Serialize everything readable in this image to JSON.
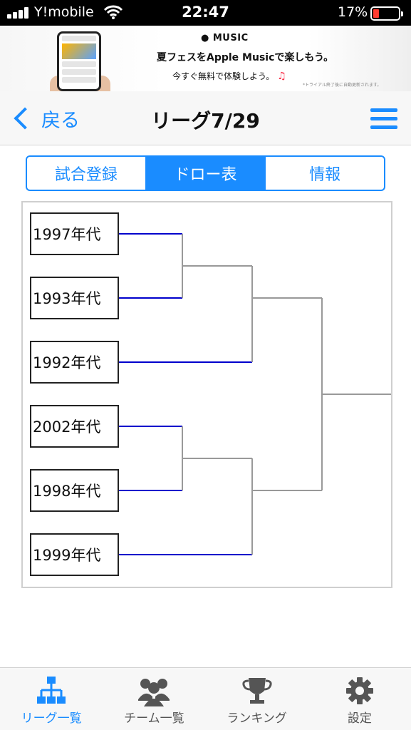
{
  "status_bar": {
    "carrier": "Y!mobile",
    "time": "22:47",
    "battery": "17%"
  },
  "ad": {
    "brand": "MUSIC",
    "headline": "夏フェスをApple Musicで楽しもう。",
    "cta": "今すぐ無料で体験しよう。",
    "fine_print": "*トライアル終了後に自動更新されます。"
  },
  "nav": {
    "back_label": "戻る",
    "title": "リーグ7/29"
  },
  "tabs": [
    {
      "label": "試合登録",
      "active": false
    },
    {
      "label": "ドロー表",
      "active": true
    },
    {
      "label": "情報",
      "active": false
    }
  ],
  "bracket": {
    "teams": [
      "1997年代",
      "1993年代",
      "1992年代",
      "2002年代",
      "1998年代",
      "1999年代"
    ],
    "line_colors": {
      "first_round": "#0000cc",
      "later_rounds": "#999999"
    }
  },
  "tabbar": [
    {
      "label": "リーグ一覧",
      "icon": "hierarchy-icon",
      "active": true
    },
    {
      "label": "チーム一覧",
      "icon": "users-icon",
      "active": false
    },
    {
      "label": "ランキング",
      "icon": "trophy-icon",
      "active": false
    },
    {
      "label": "設定",
      "icon": "gear-icon",
      "active": false
    }
  ],
  "colors": {
    "accent": "#1a8cff"
  }
}
